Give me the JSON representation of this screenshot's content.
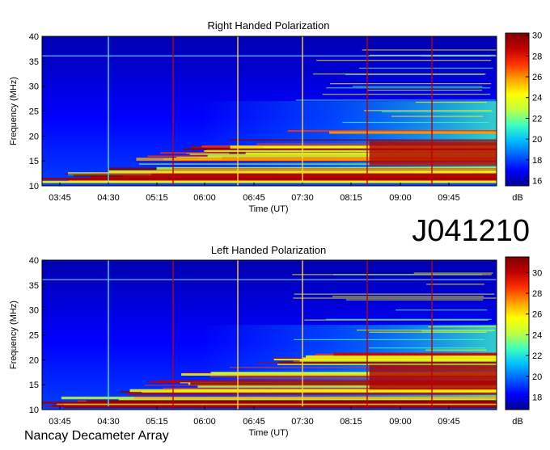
{
  "header": {
    "observation_id": "J041210"
  },
  "footer": {
    "instrument": "Nancay Decameter Array"
  },
  "colormap": [
    "#00008f",
    "#0000ff",
    "#0060ff",
    "#00c0ff",
    "#40ffbf",
    "#bfff40",
    "#ffff00",
    "#ff9f00",
    "#ff3000",
    "#c00000",
    "#800000"
  ],
  "chart_data": [
    {
      "type": "heatmap",
      "title": "Right Handed Polarization",
      "xlabel": "Time (UT)",
      "ylabel": "Frequency (MHz)",
      "x_ticks": [
        "03:45",
        "04:30",
        "05:15",
        "06:00",
        "06:45",
        "07:30",
        "08:15",
        "09:00",
        "09:45"
      ],
      "y_ticks": [
        40,
        35,
        30,
        25,
        20,
        15,
        10
      ],
      "ylim": [
        10,
        40
      ],
      "colorbar": {
        "label": "dB",
        "ticks": [
          30,
          28,
          26,
          24,
          22,
          20,
          18,
          16
        ],
        "range": [
          15.5,
          30.2
        ]
      },
      "vertical_markers": [
        {
          "time": "04:30",
          "color": "#55d6ff"
        },
        {
          "time": "05:30",
          "color": "#c00000"
        },
        {
          "time": "06:30",
          "color": "#ffd040"
        },
        {
          "time": "07:30",
          "color": "#ffd040"
        },
        {
          "time": "08:30",
          "color": "#c00000"
        },
        {
          "time": "09:30",
          "color": "#c00000"
        }
      ]
    },
    {
      "type": "heatmap",
      "title": "Left Handed Polarization",
      "xlabel": "Time (UT)",
      "ylabel": "Frequency (MHz)",
      "x_ticks": [
        "03:45",
        "04:30",
        "05:15",
        "06:00",
        "06:45",
        "07:30",
        "08:15",
        "09:00",
        "09:45"
      ],
      "y_ticks": [
        40,
        35,
        30,
        25,
        20,
        15,
        10
      ],
      "ylim": [
        10,
        40
      ],
      "colorbar": {
        "label": "dB",
        "ticks": [
          30,
          28,
          26,
          24,
          22,
          20,
          18
        ],
        "range": [
          16.8,
          31.5
        ]
      },
      "vertical_markers": [
        {
          "time": "04:30",
          "color": "#55d6ff"
        },
        {
          "time": "05:30",
          "color": "#c00000"
        },
        {
          "time": "06:30",
          "color": "#ffd040"
        },
        {
          "time": "07:30",
          "color": "#ffd040"
        },
        {
          "time": "08:30",
          "color": "#c00000"
        },
        {
          "time": "09:30",
          "color": "#c00000"
        }
      ]
    }
  ]
}
